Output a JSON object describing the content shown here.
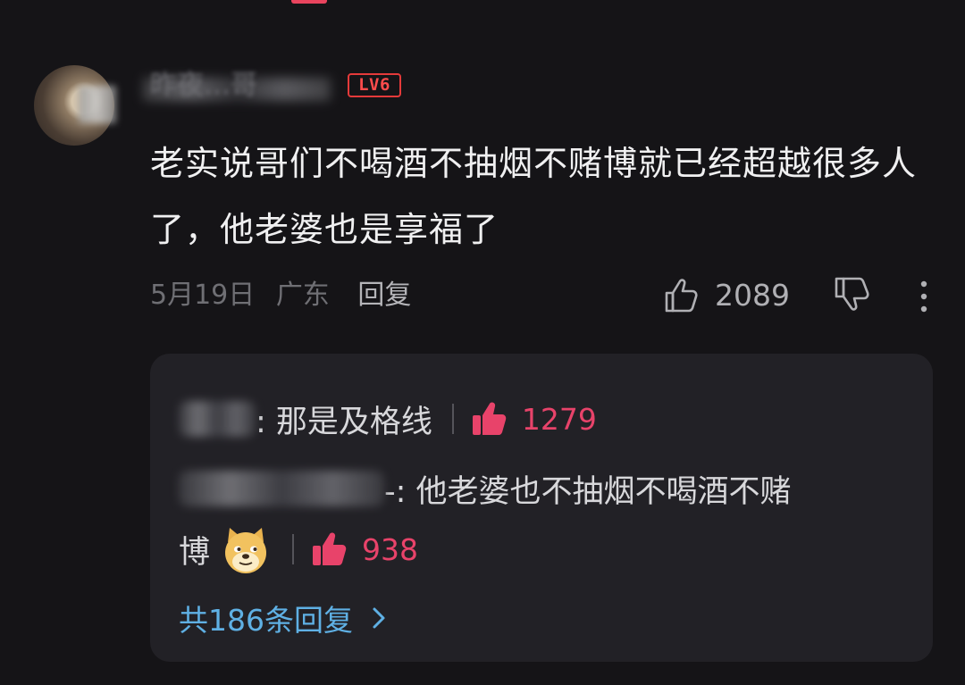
{
  "comment": {
    "username": "昨夜…哥",
    "level_badge": "LV6",
    "text": "老实说哥们不喝酒不抽烟不赌博就已经超越很多人了，他老婆也是享福了",
    "date": "5月19日",
    "location": "广东",
    "reply_label": "回复",
    "like_count": "2089"
  },
  "replies": [
    {
      "text": ": 那是及格线",
      "likes": "1279"
    },
    {
      "text_line1": "-: 他老婆也不抽烟不喝酒不赌",
      "text_line2": "博",
      "emoji": "doge-emoji",
      "likes": "938"
    }
  ],
  "more_replies_label": "共186条回复",
  "colors": {
    "background": "#151417",
    "card": "#222126",
    "accent_like": "#e8436a",
    "link_blue": "#5fb0e4",
    "level_badge": "#ff4c4c"
  }
}
